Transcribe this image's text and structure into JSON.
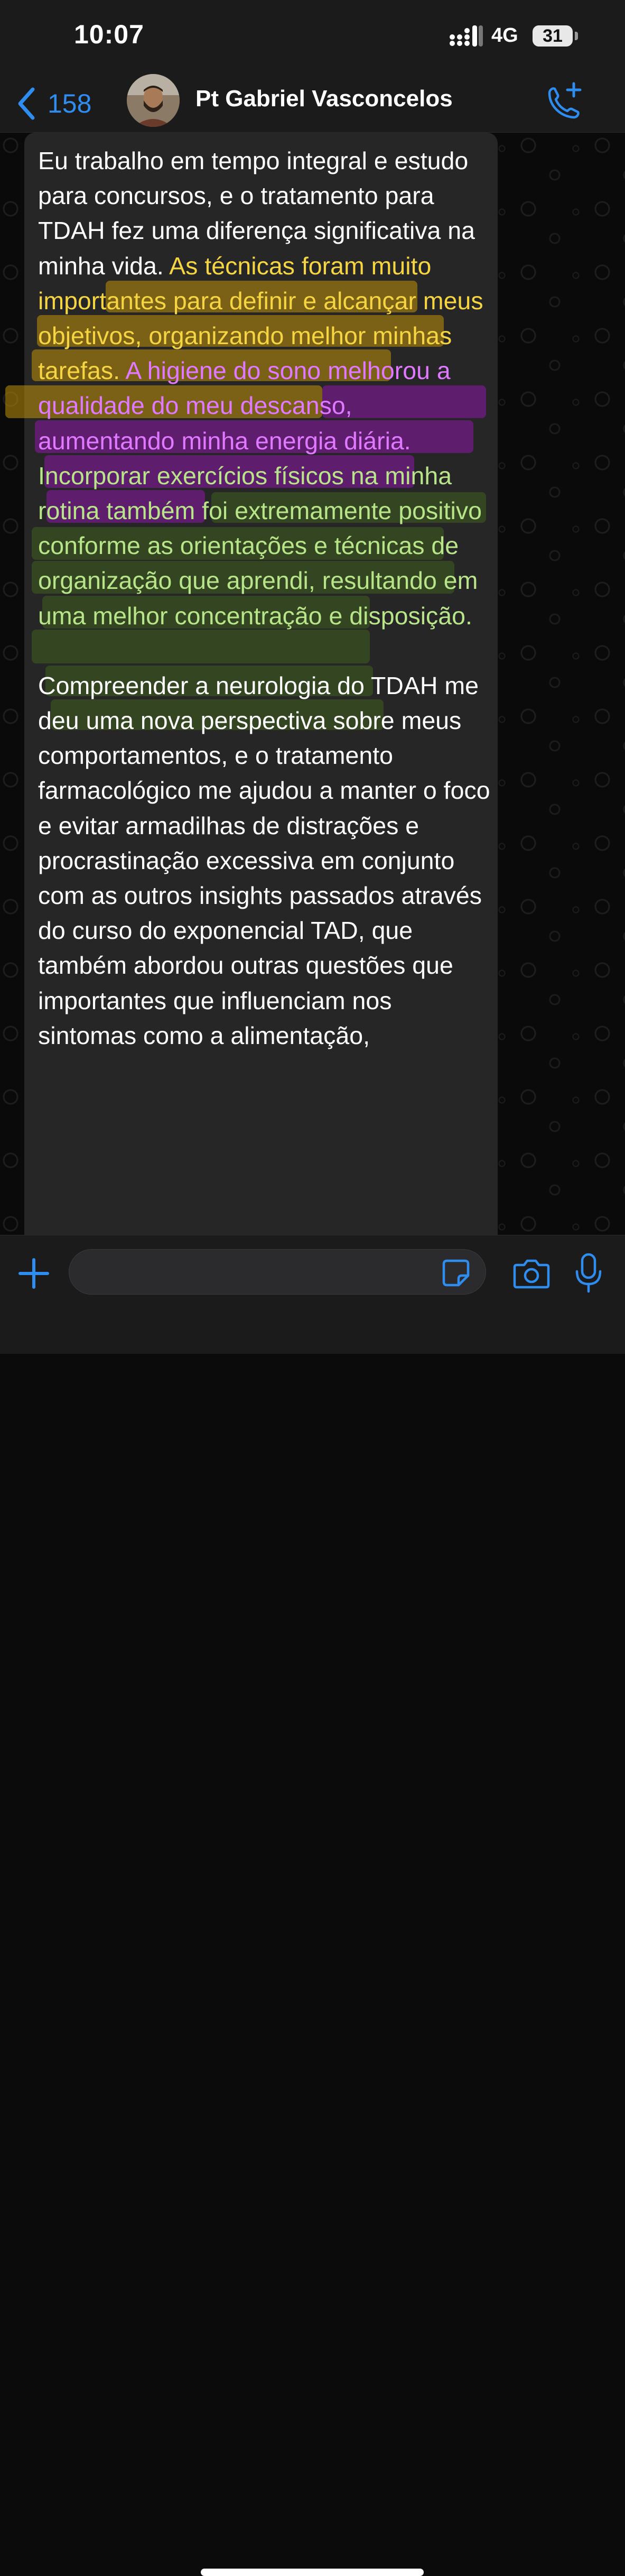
{
  "status_bar": {
    "time": "10:07",
    "network": "4G",
    "battery": "31"
  },
  "header": {
    "back_count": "158",
    "contact_name": "Pt Gabriel Vasconcelos"
  },
  "message": {
    "p1_a": "Eu trabalho em tempo integral e estudo para concursos, e o tratamento para TDAH fez uma diferença significativa na minha vida. ",
    "p1_yellow": "As técnicas foram muito importantes para definir e alcançar meus objetivos, organizando melhor minhas tarefas.",
    "p1_purple": " A higiene do sono melhorou a qualidade do meu descanso, aumentando minha energia diária.",
    "p1_green": " Incorporar exercícios físicos na minha rotina também foi extremamente positivo conforme as orientações e técnicas de organização que aprendi, resultando em uma melhor concentração e disposição.",
    "p2": "Compreender a neurologia do TDAH me deu uma nova perspectiva sobre meus comportamentos, e o tratamento farmacológico me ajudou a manter o foco e evitar armadilhas de distrações e procrastinação excessiva em conjunto com as outros insights passados através do curso do exponencial TAD, que também abordou outras questões que importantes que influenciam nos sintomas como a alimentação,"
  },
  "input": {
    "placeholder": ""
  },
  "colors": {
    "accent": "#2f8df0",
    "bubble": "#262627",
    "highlight_yellow": "#c0910a",
    "highlight_purple": "#781a8c",
    "highlight_green": "#3e601e"
  },
  "icons": [
    "back-chevron-icon",
    "call-plus-icon",
    "plus-icon",
    "sticker-icon",
    "camera-icon",
    "mic-icon"
  ]
}
